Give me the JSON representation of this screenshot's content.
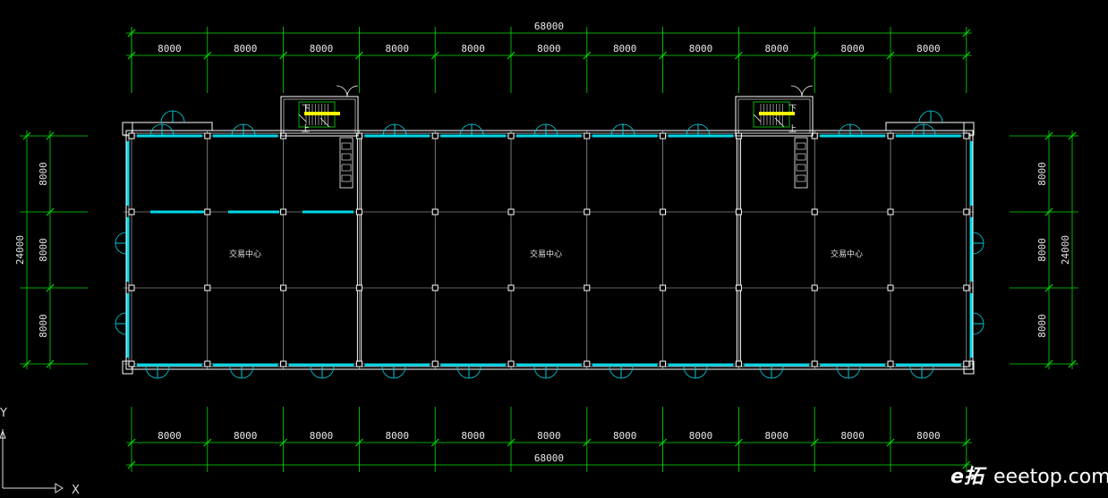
{
  "drawing": {
    "top_dimensions": {
      "overall": "68000",
      "bays": [
        "8000",
        "8000",
        "8000",
        "8000",
        "8000",
        "8000",
        "8000",
        "8000",
        "8000",
        "8000",
        "8000"
      ]
    },
    "bottom_dimensions": {
      "overall": "68000",
      "bays": [
        "8000",
        "8000",
        "8000",
        "8000",
        "8000",
        "8000",
        "8000",
        "8000",
        "8000",
        "8000",
        "8000"
      ]
    },
    "left_dimensions": {
      "overall": "24000",
      "bays": [
        "8000",
        "8000",
        "8000"
      ]
    },
    "right_dimensions": {
      "overall": "24000",
      "bays": [
        "8000",
        "8000",
        "8000"
      ]
    },
    "rooms": [
      "交易中心",
      "交易中心",
      "交易中心"
    ],
    "stairs": [
      {
        "down_label": "下",
        "up_label": "上"
      },
      {
        "down_label": "下",
        "up_label": "上"
      }
    ],
    "ucs": {
      "x_label": "X",
      "y_label": "Y"
    },
    "watermark": {
      "logo": "e拓",
      "site": "eeetop.com"
    },
    "colors": {
      "dimension": "#00e000",
      "wall": "#ffffff",
      "glazing": "#00d8e8",
      "grid": "#c8c8c8",
      "stair": "#ffff00",
      "background": "#000000"
    }
  }
}
